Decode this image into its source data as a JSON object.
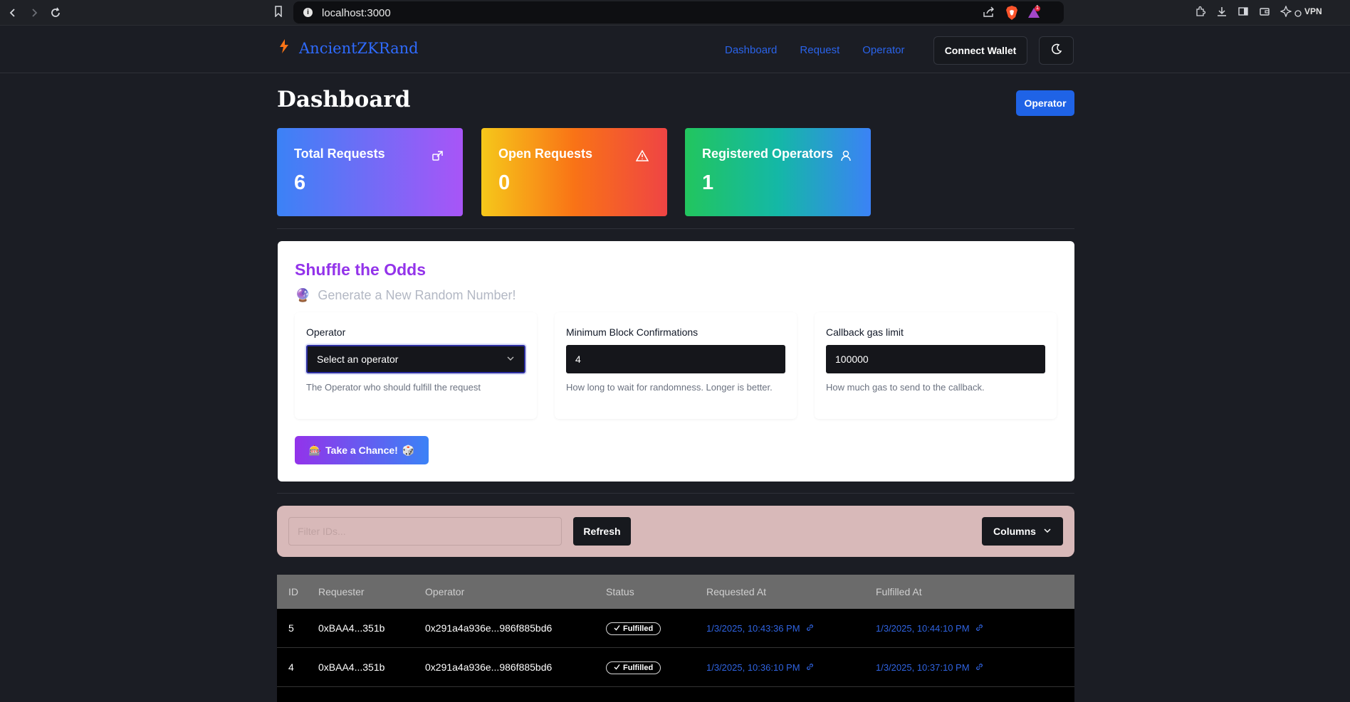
{
  "browser": {
    "url": "localhost:3000",
    "vpn_label": "VPN",
    "rewards_count": "1"
  },
  "header": {
    "brand": "AncientZKRand",
    "nav": [
      "Dashboard",
      "Request",
      "Operator"
    ],
    "connect_wallet": "Connect Wallet"
  },
  "page": {
    "title": "Dashboard",
    "operator_button": "Operator"
  },
  "stats": [
    {
      "label": "Total Requests",
      "value": "6"
    },
    {
      "label": "Open Requests",
      "value": "0"
    },
    {
      "label": "Registered Operators",
      "value": "1"
    }
  ],
  "shuffle": {
    "title": "Shuffle the Odds",
    "subtitle": "Generate a New Random Number!",
    "subtitle_emoji": "🔮",
    "fields": [
      {
        "label": "Operator",
        "value": "Select an operator",
        "help": "The Operator who should fulfill the request"
      },
      {
        "label": "Minimum Block Confirmations",
        "value": "4",
        "help": "How long to wait for randomness. Longer is better."
      },
      {
        "label": "Callback gas limit",
        "value": "100000",
        "help": "How much gas to send to the callback."
      }
    ],
    "submit_label": "Take a Chance!",
    "submit_emoji_left": "🎰",
    "submit_emoji_right": "🎲"
  },
  "toolbar": {
    "filter_placeholder": "Filter IDs...",
    "refresh_label": "Refresh",
    "columns_label": "Columns"
  },
  "table": {
    "headers": [
      "ID",
      "Requester",
      "Operator",
      "Status",
      "Requested At",
      "Fulfilled At"
    ],
    "rows": [
      {
        "id": "5",
        "requester": "0xBAA4...351b",
        "operator": "0x291a4a936e...986f885bd6",
        "status": "Fulfilled",
        "requested_at": "1/3/2025, 10:43:36 PM",
        "fulfilled_at": "1/3/2025, 10:44:10 PM"
      },
      {
        "id": "4",
        "requester": "0xBAA4...351b",
        "operator": "0x291a4a936e...986f885bd6",
        "status": "Fulfilled",
        "requested_at": "1/3/2025, 10:36:10 PM",
        "fulfilled_at": "1/3/2025, 10:37:10 PM"
      },
      {
        "id": "",
        "requester": "",
        "operator": "",
        "status": "",
        "requested_at": "",
        "fulfilled_at": ""
      }
    ]
  },
  "colors": {
    "accent_blue": "#2f6bff",
    "brand_bolt": "#f97316",
    "title_purple": "#9333ea",
    "toolbar_bg": "#d8b9b9"
  }
}
